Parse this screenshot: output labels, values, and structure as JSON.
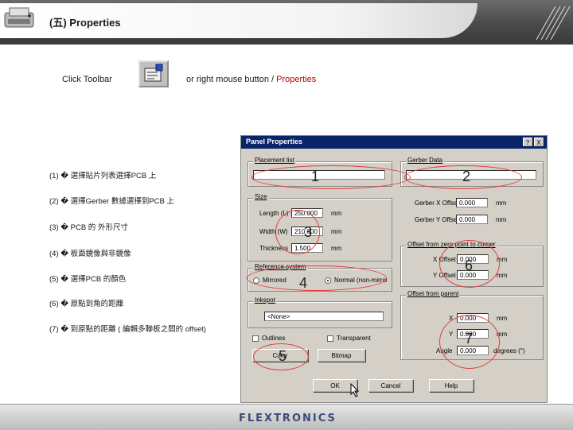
{
  "slide_title": "(五) Properties",
  "instruction": {
    "click_toolbar": "Click Toolbar",
    "or_right_mouse": "or right mouse button / ",
    "properties": "Properties"
  },
  "items": [
    "(1) � 選擇貼片列表選擇PCB 上",
    "(2) � 選擇Gerber 數據選擇到PCB 上",
    "(3) � PCB 的 外形尺寸",
    "(4) � 板面鏡像與非鏡像",
    "(5) � 選擇PCB 的顏色",
    "(6) � 原點到角的距離",
    "(7) � 到原點的距離 ( 編輯多聯板之間的 offset)"
  ],
  "dialog": {
    "title": "Panel Properties",
    "help_btn": "?",
    "close_btn": "X",
    "placement_list_label": "Placement list",
    "gerber_data_label": "Gerber Data",
    "size_label": "Size",
    "length_label": "Length (L)",
    "length_value": "250.000",
    "width_label": "Width (W)",
    "width_value": "210.000",
    "thickness_label": "Thickness",
    "thickness_value": "1.500",
    "mm": "mm",
    "gerber_x_label": "Gerber X Offset",
    "gerber_x_value": "0.000",
    "gerber_y_label": "Gerber Y Offset",
    "gerber_y_value": "0.000",
    "offset_corner_label": "Offset from zero point to corner",
    "xoffset_label": "X Offset",
    "xoffset_value": "0.000",
    "yoffset_label": "Y Offset",
    "yoffset_value": "0.000",
    "reference_label": "Reference system",
    "mirrored": "Mirrored",
    "normal": "Normal (non-mirrored)",
    "inkspot_label": "Inkspot",
    "inkspot_value": "<None>",
    "offset_parent_label": "Offset from parent",
    "x_label": "X",
    "x_value": "0.000",
    "y_label": "Y",
    "y_value": "0.000",
    "angle_label": "Angle",
    "angle_value": "0.000",
    "degrees": "degrees (°)",
    "outlines": "Outlines",
    "transparent": "Transparent",
    "color_btn": "Color",
    "bitmap_btn": "Bitmap",
    "ok_btn": "OK",
    "cancel_btn": "Cancel",
    "help_button": "Help"
  },
  "callouts": [
    "1",
    "2",
    "3",
    "4",
    "5",
    "6",
    "7"
  ],
  "footer": "FLEXTRONICS",
  "colors": {
    "callout": "#e23b3b",
    "title_bar": "#0a246a",
    "accent_red": "#c00000"
  }
}
